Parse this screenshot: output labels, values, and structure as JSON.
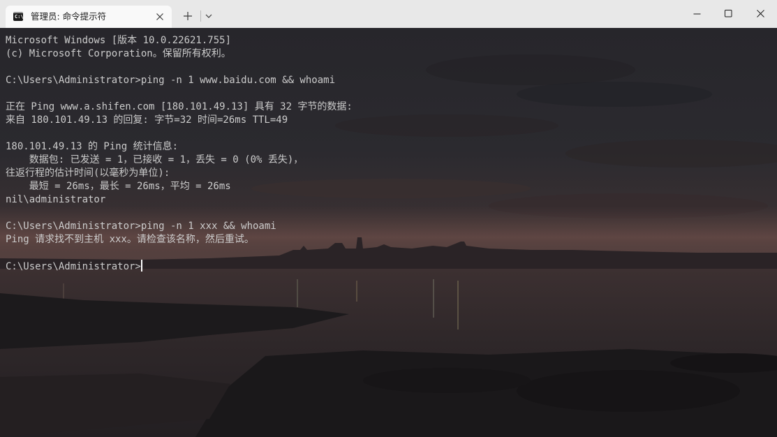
{
  "tab": {
    "icon_text": "C:\\",
    "title": "管理员: 命令提示符"
  },
  "icons": {
    "tab_close": "close-icon",
    "new_tab": "plus-icon",
    "dropdown": "chevron-down-icon",
    "minimize": "minimize-icon",
    "maximize": "maximize-icon",
    "close": "close-icon"
  },
  "colors": {
    "titlebar_bg": "#e8e8e8",
    "active_tab_bg": "#f9f9f9",
    "terminal_text": "#cccccc",
    "cursor": "#ffffff"
  },
  "terminal": {
    "lines": [
      "Microsoft Windows [版本 10.0.22621.755]",
      "(c) Microsoft Corporation。保留所有权利。",
      "",
      "C:\\Users\\Administrator>ping -n 1 www.baidu.com && whoami",
      "",
      "正在 Ping www.a.shifen.com [180.101.49.13] 具有 32 字节的数据:",
      "来自 180.101.49.13 的回复: 字节=32 时间=26ms TTL=49",
      "",
      "180.101.49.13 的 Ping 统计信息:",
      "    数据包: 已发送 = 1，已接收 = 1，丢失 = 0 (0% 丢失)，",
      "往返行程的估计时间(以毫秒为单位):",
      "    最短 = 26ms，最长 = 26ms，平均 = 26ms",
      "nil\\administrator",
      "",
      "C:\\Users\\Administrator>ping -n 1 xxx && whoami",
      "Ping 请求找不到主机 xxx。请检查该名称，然后重试。",
      ""
    ],
    "prompt": "C:\\Users\\Administrator>"
  }
}
